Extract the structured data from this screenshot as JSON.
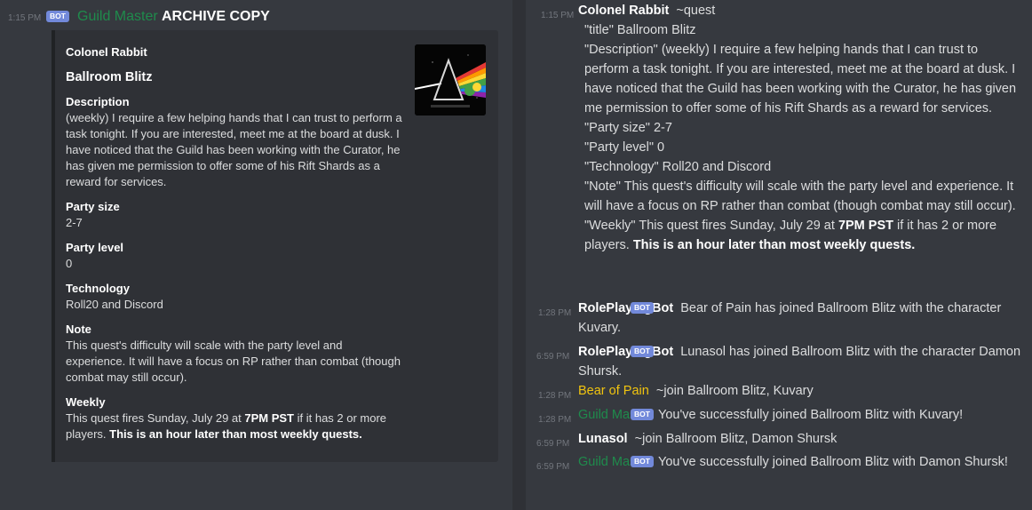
{
  "left": {
    "time": "1:15 PM",
    "badge": "BOT",
    "author": "Guild Master",
    "title": "ARCHIVE COPY",
    "embed": {
      "author": "Colonel Rabbit",
      "title": "Ballroom Blitz",
      "fields": [
        {
          "name": "Description",
          "value": "(weekly) I require a few helping hands that I can trust to perform a task tonight. If you are interested, meet me at the board at dusk. I have noticed that the Guild has been working with the Curator, he has given me permission to offer some of his Rift Shards as a reward for services."
        },
        {
          "name": "Party size",
          "value": "2-7"
        },
        {
          "name": "Party level",
          "value": "0"
        },
        {
          "name": "Technology",
          "value": "Roll20 and Discord"
        },
        {
          "name": "Note",
          "value": "This quest's difficulty will scale with the party level and experience. It will have a focus on RP rather than combat (though combat may still occur)."
        }
      ],
      "weekly": {
        "name": "Weekly",
        "pre": "This quest fires Sunday, July 29 at ",
        "bold1": "7PM PST",
        "mid": " if it has 2 or more players. ",
        "bold2": "This is an hour later than most weekly quests."
      }
    }
  },
  "right": {
    "quest": {
      "time": "1:15 PM",
      "user": "Colonel Rabbit",
      "cmd": "~quest",
      "lines": [
        "\"title\" Ballroom Blitz",
        "\"Description\" (weekly) I require a few helping hands that I can trust to perform a task tonight. If you are interested, meet me at the board at dusk. I have noticed that the Guild has been working with the Curator, he has given me permission to offer some of his Rift Shards as a reward for services.",
        "\"Party size\" 2-7",
        "\"Party level\" 0",
        "\"Technology\" Roll20 and Discord",
        "\"Note\" This quest's difficulty will scale with the party level and experience. It will have a focus on RP rather than combat (though combat may still occur)."
      ],
      "weekly_pre": "\"Weekly\" This quest fires Sunday, July 29 at ",
      "weekly_b1": "7PM PST",
      "weekly_mid": " if it has 2 or more players. ",
      "weekly_b2": "This is an hour later than most weekly quests."
    },
    "messages": [
      {
        "time": "1:28 PM",
        "badge": "BOT",
        "user": "RolePlayingBot",
        "text": "Bear of Pain has joined Ballroom Blitz with the character Kuvary."
      },
      {
        "time": "6:59 PM",
        "badge": "BOT",
        "user": "RolePlayingBot",
        "text": "Lunasol has joined Ballroom Blitz with the character Damon Shursk."
      },
      {
        "time": "1:28 PM",
        "user": "Bear of Pain",
        "text": "~join Ballroom Blitz, Kuvary"
      },
      {
        "time": "1:28 PM",
        "badge": "BOT",
        "user": "Guild Master",
        "text": "You've successfully joined Ballroom Blitz with Kuvary!"
      },
      {
        "time": "6:59 PM",
        "user": "Lunasol",
        "text": "~join Ballroom Blitz, Damon Shursk"
      },
      {
        "time": "6:59 PM",
        "badge": "BOT",
        "user": "Guild Master",
        "text": "You've successfully joined Ballroom Blitz with Damon Shursk!"
      }
    ]
  }
}
